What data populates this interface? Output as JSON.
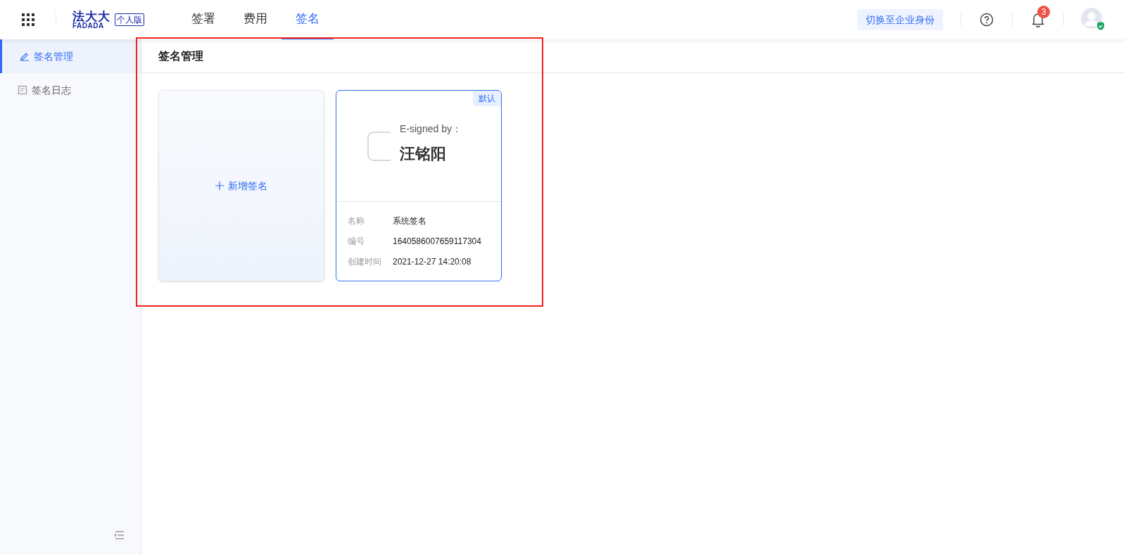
{
  "header": {
    "logo": {
      "name": "法大大",
      "latin": "FADADA",
      "edition": "个人版"
    },
    "nav": [
      {
        "label": "签署",
        "selected": false
      },
      {
        "label": "费用",
        "selected": false
      },
      {
        "label": "签名",
        "selected": true
      }
    ],
    "switch_button": "切换至企业身份",
    "notifications": {
      "count": "3"
    }
  },
  "sidebar": {
    "items": [
      {
        "label": "签名管理",
        "kind": "edit",
        "selected": true
      },
      {
        "label": "签名日志",
        "kind": "log",
        "selected": false
      }
    ]
  },
  "page": {
    "title": "签名管理",
    "add_card": {
      "label": "新增签名"
    },
    "signatures": [
      {
        "default_tag": "默认",
        "signed_by": "E-signed by：",
        "signer": "汪铭阳",
        "fields": [
          {
            "label": "名称",
            "value": "系统签名"
          },
          {
            "label": "编号",
            "value": "1640586007659117304"
          },
          {
            "label": "创建时间",
            "value": "2021-12-27 14:20:08"
          }
        ]
      }
    ]
  }
}
